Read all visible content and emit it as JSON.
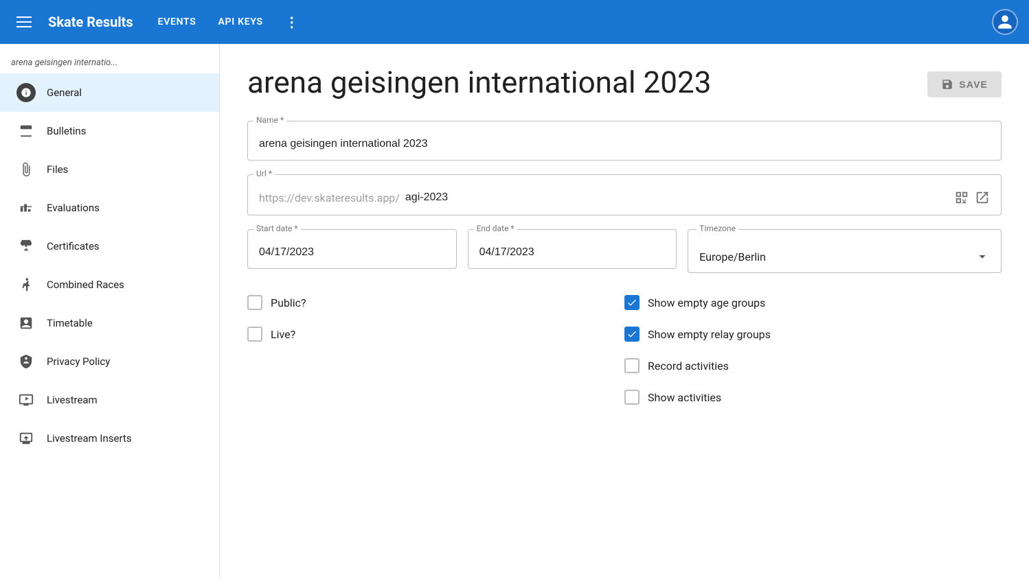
{
  "topnav": {
    "brand": "Skate Results",
    "links": [
      "EVENTS",
      "API KEYS"
    ],
    "more_label": "⋮"
  },
  "sidebar": {
    "event_title": "arena geisingen internatio...",
    "items": [
      {
        "id": "general",
        "label": "General",
        "icon": "info",
        "active": true
      },
      {
        "id": "bulletins",
        "label": "Bulletins",
        "icon": "calendar"
      },
      {
        "id": "files",
        "label": "Files",
        "icon": "paperclip"
      },
      {
        "id": "evaluations",
        "label": "Evaluations",
        "icon": "chart"
      },
      {
        "id": "certificates",
        "label": "Certificates",
        "icon": "trophy"
      },
      {
        "id": "combined-races",
        "label": "Combined Races",
        "icon": "person-running"
      },
      {
        "id": "timetable",
        "label": "Timetable",
        "icon": "timetable"
      },
      {
        "id": "privacy-policy",
        "label": "Privacy Policy",
        "icon": "shield"
      },
      {
        "id": "livestream",
        "label": "Livestream",
        "icon": "tv"
      },
      {
        "id": "livestream-inserts",
        "label": "Livestream Inserts",
        "icon": "screen"
      }
    ]
  },
  "page": {
    "title": "arena geisingen international 2023",
    "save_label": "SAVE"
  },
  "form": {
    "name_label": "Name *",
    "name_value": "arena geisingen international 2023",
    "url_label": "Url *",
    "url_prefix": "https://dev.skateresults.app/",
    "url_slug": "agi-2023",
    "start_date_label": "Start date *",
    "start_date_value": "04/17/2023",
    "end_date_label": "End date *",
    "end_date_value": "04/17/2023",
    "timezone_label": "Timezone",
    "timezone_value": "Europe/Berlin",
    "checkboxes": [
      {
        "id": "public",
        "label": "Public?",
        "checked": false,
        "col": 0,
        "row": 0
      },
      {
        "id": "show-empty-age",
        "label": "Show empty age groups",
        "checked": true,
        "col": 1,
        "row": 0
      },
      {
        "id": "live",
        "label": "Live?",
        "checked": false,
        "col": 0,
        "row": 1
      },
      {
        "id": "show-empty-relay",
        "label": "Show empty relay groups",
        "checked": true,
        "col": 1,
        "row": 1
      },
      {
        "id": "record-activities",
        "label": "Record activities",
        "checked": false,
        "col": 1,
        "row": 2
      },
      {
        "id": "show-activities",
        "label": "Show activities",
        "checked": false,
        "col": 1,
        "row": 3
      }
    ]
  }
}
